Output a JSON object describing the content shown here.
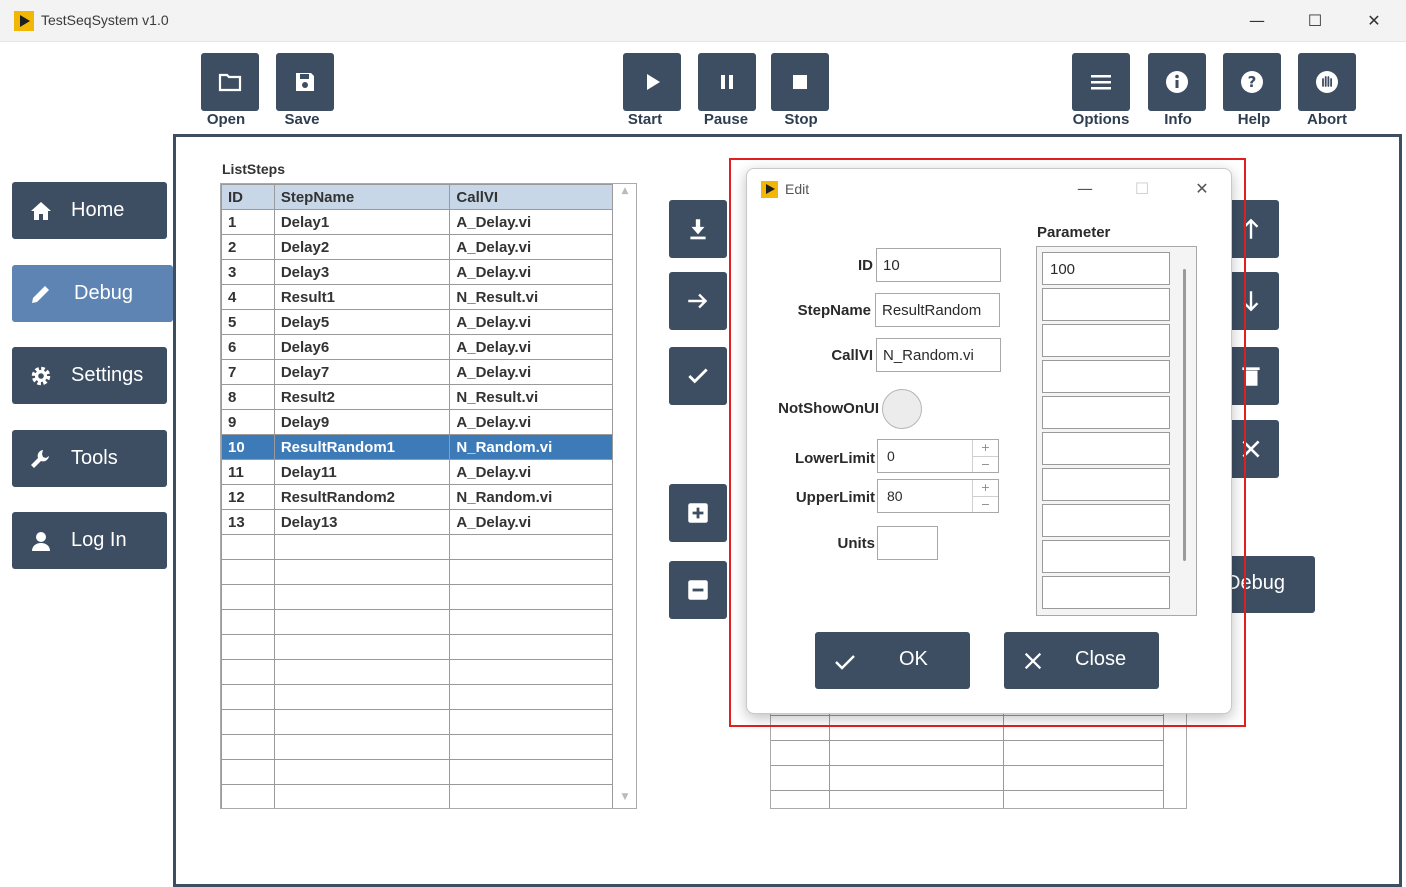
{
  "window": {
    "title": "TestSeqSystem v1.0"
  },
  "toolbar": {
    "open": "Open",
    "save": "Save",
    "start": "Start",
    "pause": "Pause",
    "stop": "Stop",
    "options": "Options",
    "info": "Info",
    "help": "Help",
    "abort": "Abort"
  },
  "sidebar": {
    "items": [
      {
        "label": "Home",
        "icon": "home-icon"
      },
      {
        "label": "Debug",
        "icon": "pencil-icon",
        "active": true
      },
      {
        "label": "Settings",
        "icon": "gear-icon"
      },
      {
        "label": "Tools",
        "icon": "wrench-icon"
      },
      {
        "label": "Log In",
        "icon": "user-icon"
      }
    ]
  },
  "list_steps": {
    "title": "ListSteps",
    "columns": [
      "ID",
      "StepName",
      "CallVI"
    ],
    "rows": [
      [
        "1",
        "Delay1",
        "A_Delay.vi"
      ],
      [
        "2",
        "Delay2",
        "A_Delay.vi"
      ],
      [
        "3",
        "Delay3",
        "A_Delay.vi"
      ],
      [
        "4",
        "Result1",
        "N_Result.vi"
      ],
      [
        "5",
        "Delay5",
        "A_Delay.vi"
      ],
      [
        "6",
        "Delay6",
        "A_Delay.vi"
      ],
      [
        "7",
        "Delay7",
        "A_Delay.vi"
      ],
      [
        "8",
        "Result2",
        "N_Result.vi"
      ],
      [
        "9",
        "Delay9",
        "A_Delay.vi"
      ],
      [
        "10",
        "ResultRandom1",
        "N_Random.vi"
      ],
      [
        "11",
        "Delay11",
        "A_Delay.vi"
      ],
      [
        "12",
        "ResultRandom2",
        "N_Random.vi"
      ],
      [
        "13",
        "Delay13",
        "A_Delay.vi"
      ]
    ],
    "selected_index": 9,
    "empty_rows": 11
  },
  "debug_button": "Debug",
  "edit_dialog": {
    "title": "Edit",
    "id_label": "ID",
    "id_value": "10",
    "stepname_label": "StepName",
    "stepname_value": "ResultRandom",
    "callvi_label": "CallVI",
    "callvi_value": "N_Random.vi",
    "notshow_label": "NotShowOnUI",
    "lower_label": "LowerLimit",
    "lower_value": "0",
    "upper_label": "UpperLimit",
    "upper_value": "80",
    "units_label": "Units",
    "units_value": "",
    "parameter_label": "Parameter",
    "parameters": [
      "100",
      "",
      "",
      "",
      "",
      "",
      "",
      "",
      "",
      ""
    ],
    "ok": "OK",
    "close": "Close"
  },
  "colors": {
    "button": "#3d4e62",
    "active": "#5d84b2",
    "selected_row": "#3d7ab8",
    "highlight_frame": "#e02020"
  }
}
